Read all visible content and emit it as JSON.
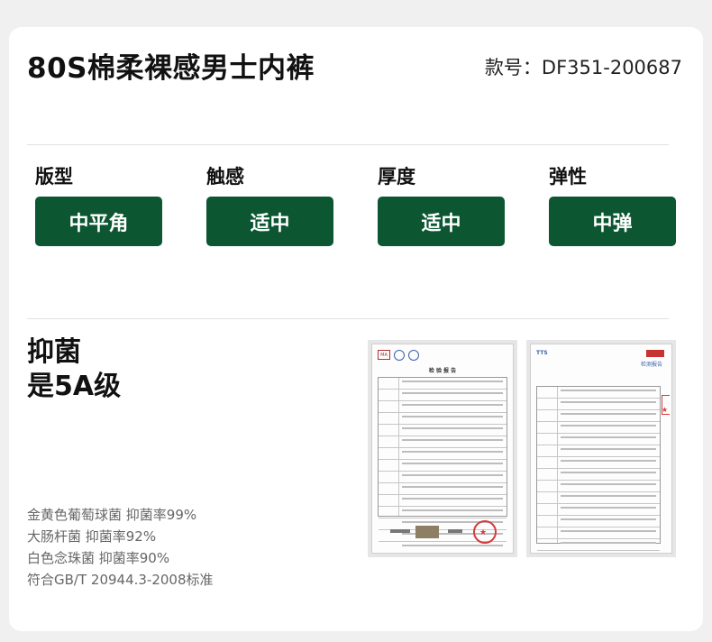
{
  "product": {
    "title": "80S棉柔裸感男士内裤",
    "model": "款号：DF351-200687"
  },
  "attributes": [
    {
      "label": "版型",
      "value": "中平角"
    },
    {
      "label": "触感",
      "value": "适中"
    },
    {
      "label": "厚度",
      "value": "适中"
    },
    {
      "label": "弹性",
      "value": "中弹"
    }
  ],
  "antibacterial": {
    "title_line1": "抑菌",
    "title_line2": "是5A级",
    "items": [
      "金黄色葡萄球菌 抑菌率99%",
      "大肠杆菌 抑菌率92%",
      "白色念珠菌 抑菌率90%",
      "符合GB/T 20944.3-2008标准"
    ]
  },
  "reports": {
    "report1_title": "检 验 报 告",
    "report2_header": "TTS",
    "report2_title": "检测报告"
  },
  "colors": {
    "accent_green": "#0c5632",
    "stamp_red": "#d83a3a"
  }
}
